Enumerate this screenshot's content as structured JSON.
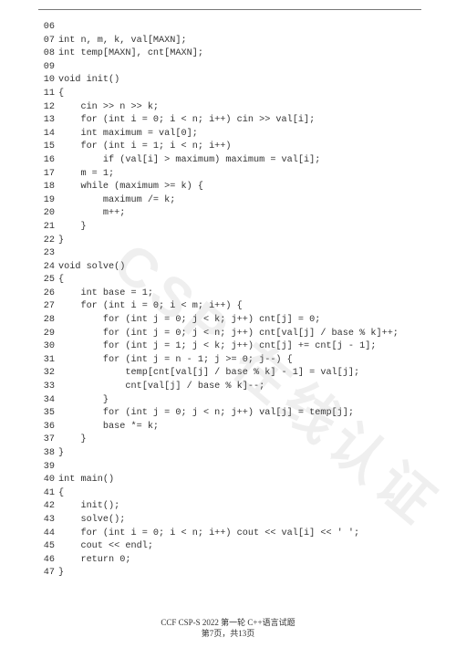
{
  "watermark": "CSP 在线认证",
  "footer": {
    "line1": "CCF CSP-S 2022 第一轮 C++语言试题",
    "line2": "第7页，共13页"
  },
  "code_lines": [
    {
      "n": "06",
      "t": ""
    },
    {
      "n": "07",
      "t": "int n, m, k, val[MAXN];"
    },
    {
      "n": "08",
      "t": "int temp[MAXN], cnt[MAXN];"
    },
    {
      "n": "09",
      "t": ""
    },
    {
      "n": "10",
      "t": "void init()"
    },
    {
      "n": "11",
      "t": "{"
    },
    {
      "n": "12",
      "t": "    cin >> n >> k;"
    },
    {
      "n": "13",
      "t": "    for (int i = 0; i < n; i++) cin >> val[i];"
    },
    {
      "n": "14",
      "t": "    int maximum = val[0];"
    },
    {
      "n": "15",
      "t": "    for (int i = 1; i < n; i++)"
    },
    {
      "n": "16",
      "t": "        if (val[i] > maximum) maximum = val[i];"
    },
    {
      "n": "17",
      "t": "    m = 1;"
    },
    {
      "n": "18",
      "t": "    while (maximum >= k) {"
    },
    {
      "n": "19",
      "t": "        maximum /= k;"
    },
    {
      "n": "20",
      "t": "        m++;"
    },
    {
      "n": "21",
      "t": "    }"
    },
    {
      "n": "22",
      "t": "}"
    },
    {
      "n": "23",
      "t": ""
    },
    {
      "n": "24",
      "t": "void solve()"
    },
    {
      "n": "25",
      "t": "{"
    },
    {
      "n": "26",
      "t": "    int base = 1;"
    },
    {
      "n": "27",
      "t": "    for (int i = 0; i < m; i++) {"
    },
    {
      "n": "28",
      "t": "        for (int j = 0; j < k; j++) cnt[j] = 0;"
    },
    {
      "n": "29",
      "t": "        for (int j = 0; j < n; j++) cnt[val[j] / base % k]++;"
    },
    {
      "n": "30",
      "t": "        for (int j = 1; j < k; j++) cnt[j] += cnt[j - 1];"
    },
    {
      "n": "31",
      "t": "        for (int j = n - 1; j >= 0; j--) {"
    },
    {
      "n": "32",
      "t": "            temp[cnt[val[j] / base % k] - 1] = val[j];"
    },
    {
      "n": "33",
      "t": "            cnt[val[j] / base % k]--;"
    },
    {
      "n": "34",
      "t": "        }"
    },
    {
      "n": "35",
      "t": "        for (int j = 0; j < n; j++) val[j] = temp[j];"
    },
    {
      "n": "36",
      "t": "        base *= k;"
    },
    {
      "n": "37",
      "t": "    }"
    },
    {
      "n": "38",
      "t": "}"
    },
    {
      "n": "39",
      "t": ""
    },
    {
      "n": "40",
      "t": "int main()"
    },
    {
      "n": "41",
      "t": "{"
    },
    {
      "n": "42",
      "t": "    init();"
    },
    {
      "n": "43",
      "t": "    solve();"
    },
    {
      "n": "44",
      "t": "    for (int i = 0; i < n; i++) cout << val[i] << ' ';"
    },
    {
      "n": "45",
      "t": "    cout << endl;"
    },
    {
      "n": "46",
      "t": "    return 0;"
    },
    {
      "n": "47",
      "t": "}"
    }
  ]
}
